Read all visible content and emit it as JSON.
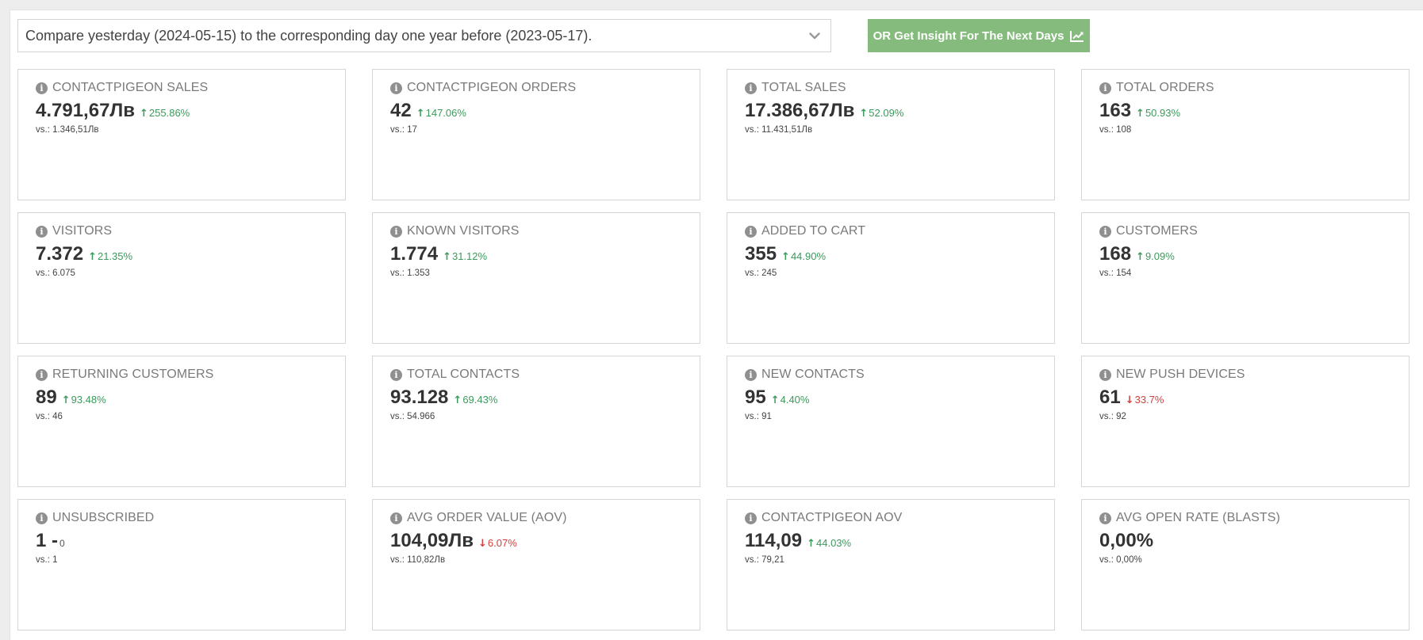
{
  "compare": {
    "label": "Compare yesterday (2024-05-15) to the corresponding day one year before (2023-05-17)."
  },
  "insight_button": {
    "label": "OR Get Insight For The Next Days",
    "icon": "line-chart-icon"
  },
  "colors": {
    "accent_green": "#85bb7c",
    "up": "#3b9a5c",
    "down": "#d0423f"
  },
  "metrics": [
    {
      "title": "CONTACTPIGEON SALES",
      "value": "4.791,67Лв",
      "change": "255.86%",
      "direction": "up",
      "vs": "vs.: 1.346,51Лв"
    },
    {
      "title": "CONTACTPIGEON ORDERS",
      "value": "42",
      "change": "147.06%",
      "direction": "up",
      "vs": "vs.: 17"
    },
    {
      "title": "TOTAL SALES",
      "value": "17.386,67Лв",
      "change": "52.09%",
      "direction": "up",
      "vs": "vs.: 11.431,51Лв"
    },
    {
      "title": "TOTAL ORDERS",
      "value": "163",
      "change": "50.93%",
      "direction": "up",
      "vs": "vs.: 108"
    },
    {
      "title": "VISITORS",
      "value": "7.372",
      "change": "21.35%",
      "direction": "up",
      "vs": "vs.: 6.075"
    },
    {
      "title": "KNOWN VISITORS",
      "value": "1.774",
      "change": "31.12%",
      "direction": "up",
      "vs": "vs.: 1.353"
    },
    {
      "title": "ADDED TO CART",
      "value": "355",
      "change": "44.90%",
      "direction": "up",
      "vs": "vs.: 245"
    },
    {
      "title": "CUSTOMERS",
      "value": "168",
      "change": "9.09%",
      "direction": "up",
      "vs": "vs.: 154"
    },
    {
      "title": "RETURNING CUSTOMERS",
      "value": "89",
      "change": "93.48%",
      "direction": "up",
      "vs": "vs.: 46"
    },
    {
      "title": "TOTAL CONTACTS",
      "value": "93.128",
      "change": "69.43%",
      "direction": "up",
      "vs": "vs.: 54.966"
    },
    {
      "title": "NEW CONTACTS",
      "value": "95",
      "change": "4.40%",
      "direction": "up",
      "vs": "vs.: 91"
    },
    {
      "title": "NEW PUSH DEVICES",
      "value": "61",
      "change": "33.7%",
      "direction": "down",
      "vs": "vs.: 92"
    },
    {
      "title": "UNSUBSCRIBED",
      "value": "1 -",
      "change": "0",
      "direction": "none",
      "vs": "vs.: 1"
    },
    {
      "title": "AVG ORDER VALUE (AOV)",
      "value": "104,09Лв",
      "change": "6.07%",
      "direction": "down",
      "vs": "vs.: 110,82Лв"
    },
    {
      "title": "CONTACTPIGEON AOV",
      "value": "114,09",
      "change": "44.03%",
      "direction": "up",
      "vs": "vs.: 79,21"
    },
    {
      "title": "AVG OPEN RATE (BLASTS)",
      "value": "0,00%",
      "change": "",
      "direction": "none",
      "vs": "vs.: 0,00%"
    }
  ]
}
